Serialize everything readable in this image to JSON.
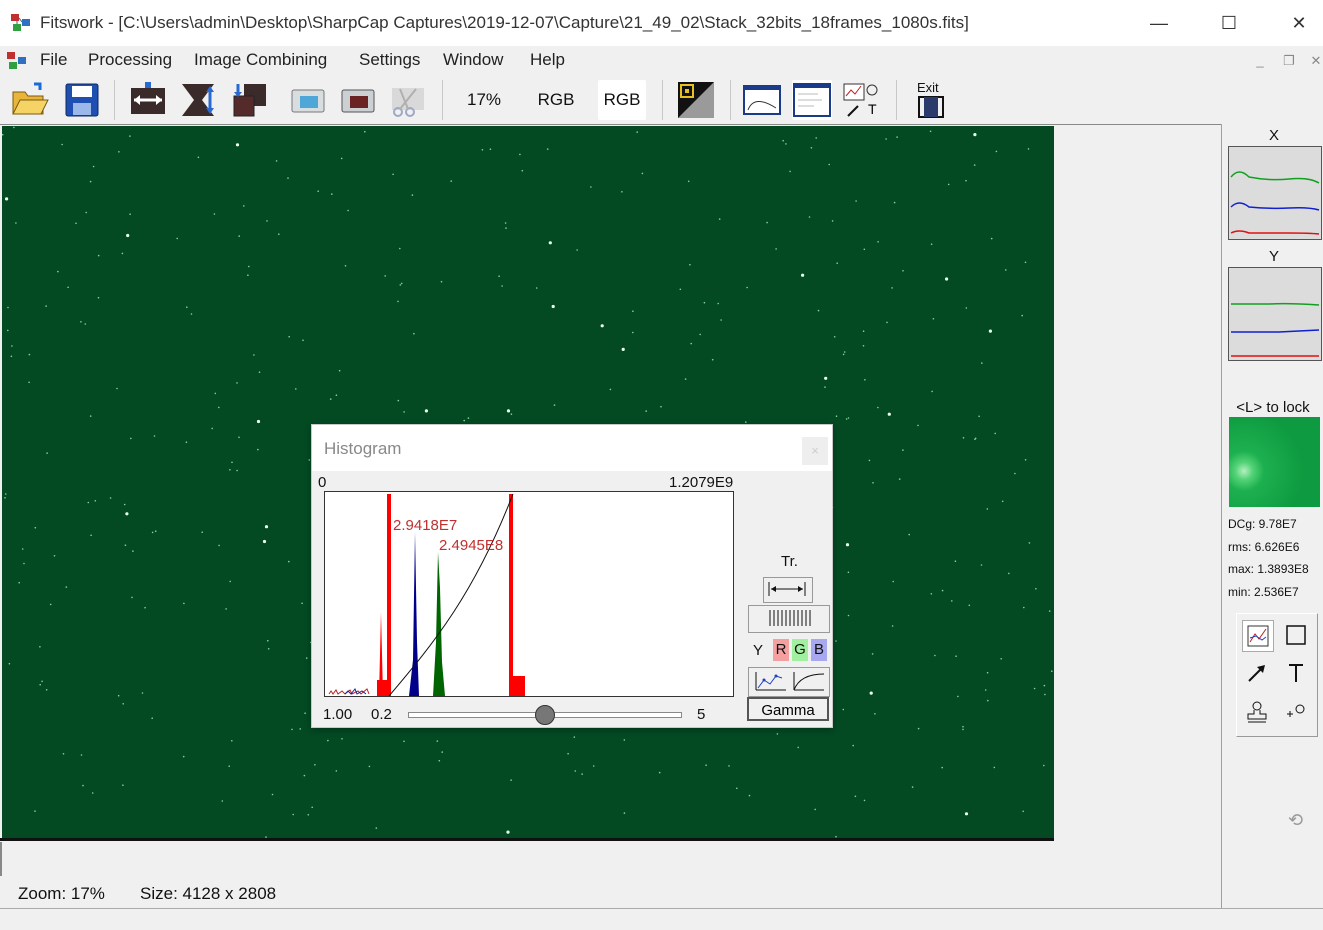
{
  "window": {
    "title": "Fitswork - [C:\\Users\\admin\\Desktop\\SharpCap Captures\\2019-12-07\\Capture\\21_49_02\\Stack_32bits_18frames_1080s.fits]",
    "minimize": "—",
    "maximize": "☐",
    "close": "✕"
  },
  "menu": {
    "items": [
      "File",
      "Processing",
      "Image Combining",
      "Settings",
      "Window",
      "Help"
    ],
    "mdi_minimize": "_",
    "mdi_restore": "❐",
    "mdi_close": "✕"
  },
  "toolbar": {
    "zoom_label": "17%",
    "rgb_label_1": "RGB",
    "rgb_label_2": "RGB",
    "exit_label": "Exit"
  },
  "status": {
    "zoom": "Zoom: 17%",
    "size": "Size: 4128 x 2808"
  },
  "right_panel": {
    "x_label": "X",
    "y_label": "Y",
    "lock_hint": "<L> to lock",
    "dcg": "DCg: 9.78E7",
    "rms": "rms: 6.626E6",
    "max": "max: 1.3893E8",
    "min": "min: 2.536E7",
    "undo": "⟲"
  },
  "histogram": {
    "title": "Histogram",
    "close": "×",
    "range_min": "0",
    "range_max": "1.2079E9",
    "marker_left": "2.9418E7",
    "marker_right": "2.4945E8",
    "tr_label": "Tr.",
    "channel_y": "Y",
    "channel_r": "R",
    "channel_g": "G",
    "channel_b": "B",
    "gamma_button": "Gamma",
    "gamma_value": "1.00",
    "slider_min": "0.2",
    "slider_max": "5",
    "slider_fraction": 0.5,
    "colors": {
      "red": "#ff0000",
      "green": "#006400",
      "blue": "#00008b"
    }
  },
  "colors": {
    "image_bg": "#034a23",
    "accent_green": "#1db050"
  }
}
